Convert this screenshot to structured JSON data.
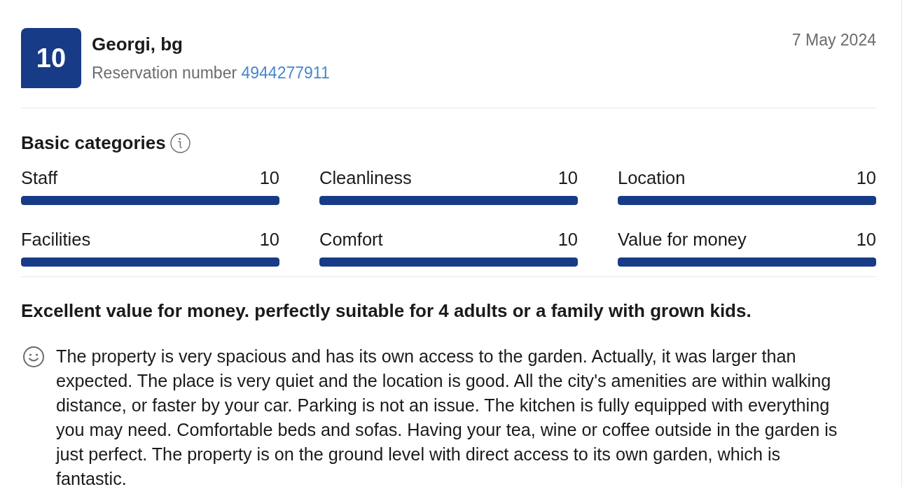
{
  "review": {
    "score": "10",
    "reviewer": "Georgi, bg",
    "reservation_label": "Reservation number",
    "reservation_number": "4944277911",
    "date": "7 May 2024"
  },
  "categories": {
    "title": "Basic categories",
    "items": [
      {
        "label": "Staff",
        "score": "10",
        "level": 1
      },
      {
        "label": "Cleanliness",
        "score": "10",
        "level": 1
      },
      {
        "label": "Location",
        "score": "10",
        "level": 1
      },
      {
        "label": "Facilities",
        "score": "10",
        "level": 1
      },
      {
        "label": "Comfort",
        "score": "10",
        "level": 1
      },
      {
        "label": "Value for money",
        "score": "10",
        "level": 1
      }
    ]
  },
  "headline": "Excellent value for money. perfectly suitable for 4 adults or a family with grown kids.",
  "comments": [
    {
      "kind": "liked",
      "text": "The property is very spacious and has its own access to the garden. Actually, it was larger than expected. The place is very quiet and the location is good. All the city's amenities are within walking distance, or faster by your car. Parking is not an issue. The kitchen is fully equipped with everything you may need. Comfortable beds and sofas. Having your tea, wine or coffee outside in the garden is just perfect. The property is on the ground level with direct access to its own garden, which is fantastic."
    }
  ]
}
